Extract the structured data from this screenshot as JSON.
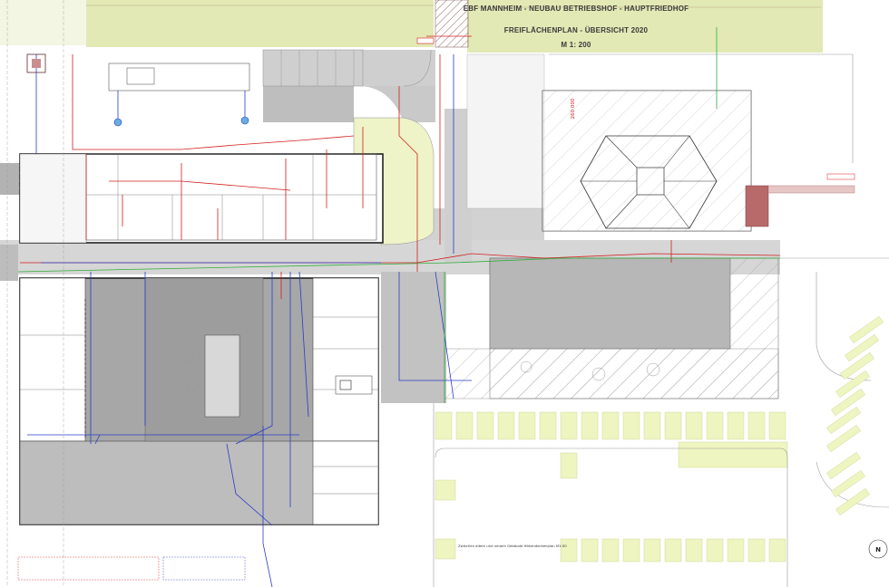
{
  "title": {
    "line1": "EBF MANNHEIM - NEUBAU BETRIEBSHOF - HAUPTFRIEDHOF",
    "line2": "FREIFLÄCHENPLAN - ÜBERSICHT 2020",
    "line3": "M 1: 200"
  },
  "labels": {
    "building_height": "260 000",
    "footnote": "Zwischen altem und neuem Gebäude Höhendeckenplan M1:50",
    "north_mark": "N"
  },
  "colors": {
    "meadow": "#e2e9b5",
    "paving": "#c8c8c8",
    "building_dark": "#a3a3a3",
    "green_area": "#eef3c8",
    "parking": "#eef5c0",
    "pipe_red": "#d21f1f",
    "pipe_blue": "#2a3cc8",
    "pipe_green": "#2fae3a",
    "road_red": "#b24545"
  }
}
